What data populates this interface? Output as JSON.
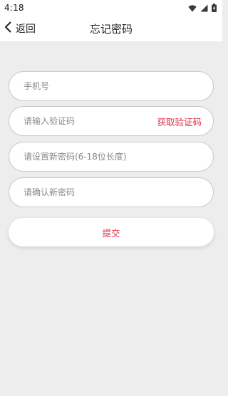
{
  "status_bar": {
    "time": "4:18",
    "icons": [
      "wifi-icon",
      "signal-icon",
      "battery-charging-icon"
    ]
  },
  "nav": {
    "back_label": "返回",
    "title": "忘记密码",
    "back_icon": "chevron-left-icon"
  },
  "form": {
    "phone_placeholder": "手机号",
    "phone_value": "",
    "code_placeholder": "请输入验证码",
    "code_value": "",
    "get_code_label": "获取验证码",
    "new_password_placeholder": "请设置新密码(6-18位长度)",
    "new_password_value": "",
    "confirm_password_placeholder": "请确认新密码",
    "confirm_password_value": "",
    "submit_label": "提交"
  },
  "colors": {
    "accent": "#e0314b",
    "background": "#ededed",
    "surface": "#ffffff"
  }
}
